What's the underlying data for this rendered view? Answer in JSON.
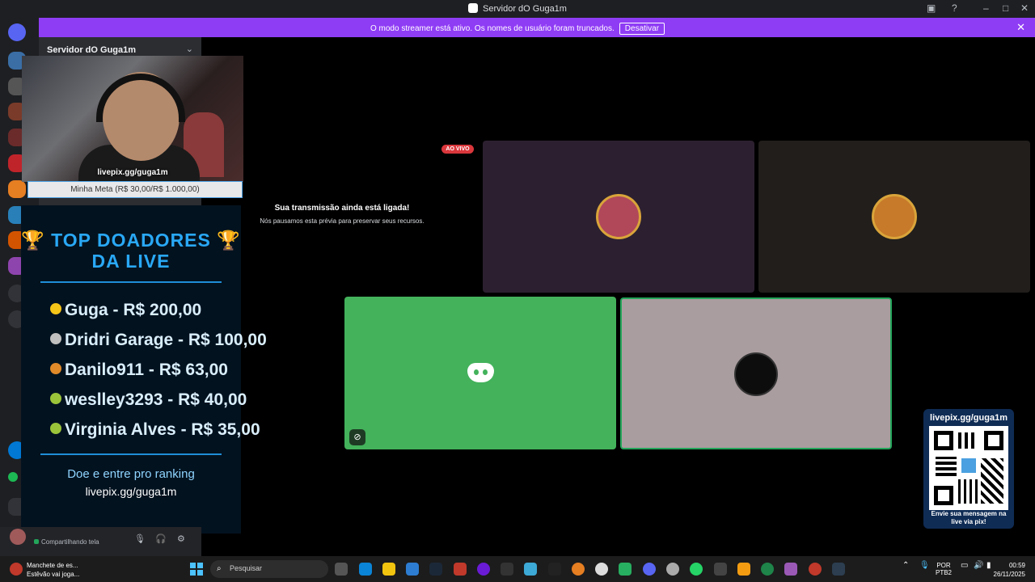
{
  "window": {
    "title": "Servidor dO Guga1m"
  },
  "banner": {
    "message": "O modo streamer está ativo. Os nomes de usuário foram truncados.",
    "button_label": "Desativar"
  },
  "sidebar": {
    "server_name": "Servidor dO Guga1m"
  },
  "overlay": {
    "camera_caption": "livepix.gg/guga1m",
    "goal_text": "Minha Meta (R$ 30,00/R$ 1.000,00)",
    "donors_title_line1": "🏆 TOP DOADORES 🏆",
    "donors_title_line2": "DA LIVE",
    "donors": [
      {
        "text": "Guga - R$ 200,00",
        "medal_color": "#f5c518"
      },
      {
        "text": "Dridri Garage - R$ 100,00",
        "medal_color": "#c0c0c0"
      },
      {
        "text": "Danilo911 - R$ 63,00",
        "medal_color": "#e08a2a"
      },
      {
        "text": "weslley3293 - R$ 40,00",
        "medal_color": "#9bc43a"
      },
      {
        "text": "Virginia Alves - R$ 35,00",
        "medal_color": "#9bc43a"
      }
    ],
    "cta": "Doe e entre pro ranking",
    "cta_link": "livepix.gg/guga1m"
  },
  "user_panel": {
    "status": "Compartilhando tela"
  },
  "stage": {
    "live_badge": "AO VIVO",
    "stream_heading": "Sua transmissão ainda está ligada!",
    "stream_sub": "Nós pausamos esta prévia para preservar seus recursos."
  },
  "qr_card": {
    "top": "livepix.gg/guga1m",
    "bottom": "Envie sua mensagem na live via pix!"
  },
  "taskbar": {
    "news_title": "Manchete de es...",
    "news_sub": "Estêvão vai joga...",
    "search_placeholder": "Pesquisar",
    "lang_line1": "POR",
    "lang_line2": "PTB2",
    "time": "00:59",
    "date": "26/11/2025"
  },
  "colors": {
    "banner": "#8f3cf5",
    "green_tile": "#43b25b",
    "accent_blue": "#29a8f5"
  }
}
